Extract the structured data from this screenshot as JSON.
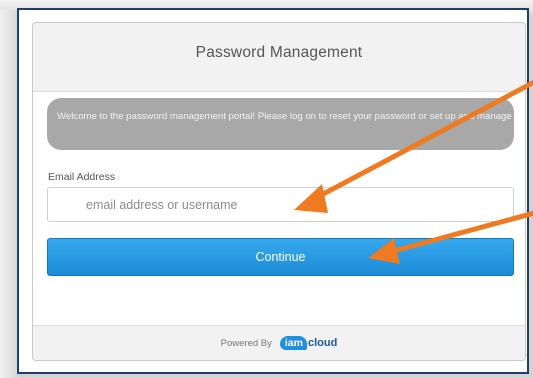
{
  "panel": {
    "title": "Password Management",
    "welcome_text": "Welcome to the password management portal! Please log on to reset your password or set up and manage your password recovery options."
  },
  "form": {
    "email_label": "Email Address",
    "email_placeholder": "email address or username",
    "email_value": "",
    "continue_label": "Continue"
  },
  "footer": {
    "powered_by": "Powered By",
    "logo_badge": "iam",
    "logo_word": "cloud"
  },
  "colors": {
    "button": "#2196e3",
    "frame_border": "#1c3f6b",
    "arrow": "#ee7a22",
    "banner": "#a8a8a8"
  },
  "annotation_icons": [
    "arrow-annotation-icon",
    "arrow-annotation-icon"
  ]
}
